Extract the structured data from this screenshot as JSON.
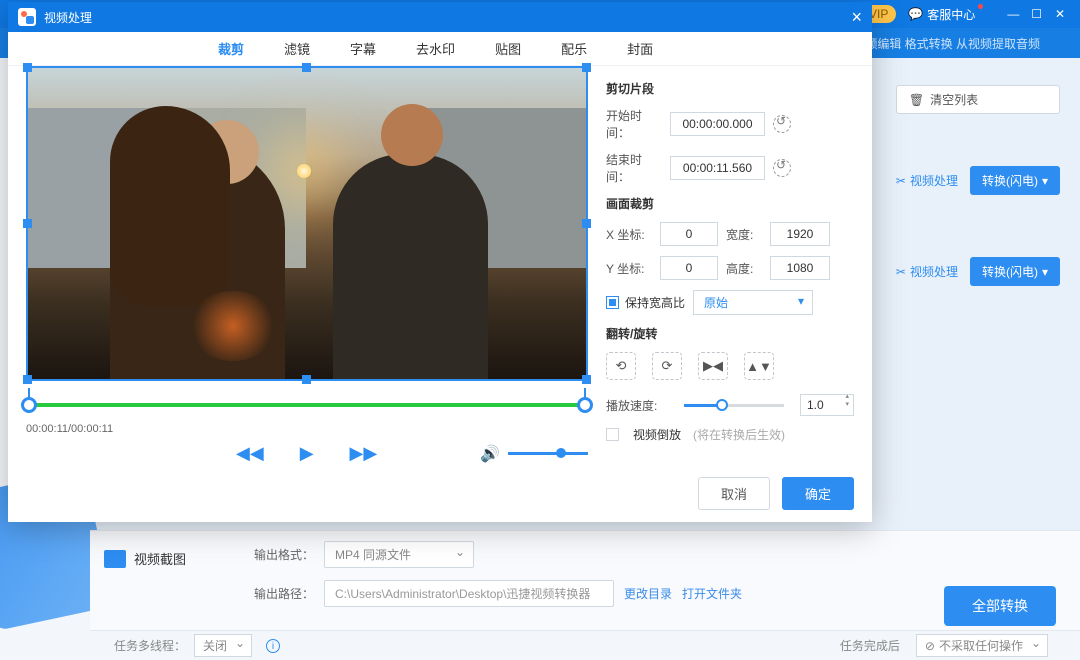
{
  "topbar": {
    "vip": "VIP",
    "service": "客服中心"
  },
  "subbar_text": "转换：视频编辑 格式转换 从视频提取音频",
  "clear_list": "清空列表",
  "row_process": "视频处理",
  "row_convert": "转换(闪电)",
  "sidebar_item": "视频截图",
  "output_format_label": "输出格式：",
  "output_format_value": "MP4  同源文件",
  "output_path_label": "输出路径：",
  "output_path_value": "C:\\Users\\Administrator\\Desktop\\迅捷视频转换器",
  "change_dir": "更改目录",
  "open_folder": "打开文件夹",
  "convert_all": "全部转换",
  "multithread_label": "任务多线程：",
  "multithread_value": "关闭",
  "after_label": "任务完成后",
  "after_value": "不采取任何操作",
  "modal": {
    "title": "视频处理",
    "tabs": [
      "裁剪",
      "滤镜",
      "字幕",
      "去水印",
      "贴图",
      "配乐",
      "封面"
    ],
    "time_display": "00:00:11/00:00:11",
    "sections": {
      "clip_title": "剪切片段",
      "start_label": "开始时间：",
      "start_value": "00:00:00.000",
      "end_label": "结束时间：",
      "end_value": "00:00:11.560",
      "crop_title": "画面裁剪",
      "x_label": "X 坐标:",
      "x_value": "0",
      "w_label": "宽度:",
      "w_value": "1920",
      "y_label": "Y 坐标:",
      "y_value": "0",
      "h_label": "高度:",
      "h_value": "1080",
      "ratio_label": "保持宽高比",
      "ratio_value": "原始",
      "rotate_title": "翻转/旋转",
      "speed_label": "播放速度:",
      "speed_value": "1.0",
      "reverse_label": "视频倒放",
      "reverse_hint": "(将在转换后生效)"
    },
    "cancel": "取消",
    "ok": "确定"
  }
}
